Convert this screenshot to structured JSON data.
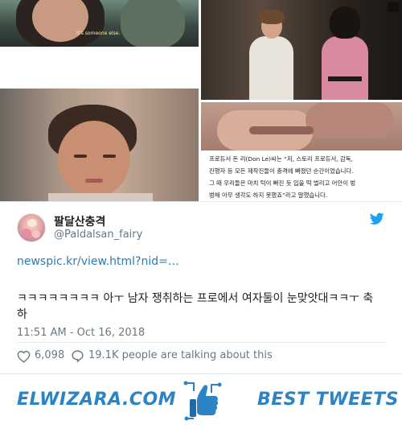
{
  "media": {
    "frame1_subtitle": "It's someone else.",
    "article_lines": [
      "프로듀서 돈 리(Don Le)씨는 “저, 스토리 프로듀서, 감독,",
      "진행자 등 모든 제작진들이 충격에 빠졌던 순간이었습니다.",
      "그 때 우리들은 마치 턱이 빠진 듯 입을 떡 벌리고 어안이 벙",
      "벙해 아무 생각도 하지 못했죠”라고 말했습니다."
    ]
  },
  "tweet": {
    "display_name": "팔달산충격",
    "handle": "@Paldalsan_fairy",
    "link": "newspic.kr/view.html?nid=…",
    "text": "ㅋㅋㅋㅋㅋㅋㅋㅋ 아ㅜ 남자 쟁취하는 프로에서 여자둘이 눈맞앗대ㅋㅋㅜ 축하",
    "timestamp": "11:51 AM - Oct 16, 2018",
    "likes": "6,098",
    "talking": "19.1K people are talking about this"
  },
  "footer": {
    "brand": "ELWIZARA.COM",
    "tagline": "BEST TWEETS"
  },
  "colors": {
    "link": "#2b7bb9",
    "twitter_blue": "#1da1f2",
    "brand_blue": "#2c84c7",
    "muted": "#697882"
  },
  "icons": [
    "twitter-logo-icon",
    "heart-icon",
    "reply-bubble-icon",
    "thumbs-up-icon"
  ]
}
